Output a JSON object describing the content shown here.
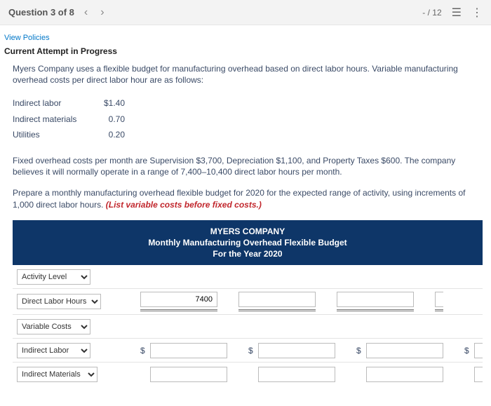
{
  "topbar": {
    "question_label": "Question 3 of 8",
    "score": "- / 12"
  },
  "links": {
    "view_policies": "View Policies"
  },
  "attempt_title": "Current Attempt in Progress",
  "body": {
    "p1": "Myers Company uses a flexible budget for manufacturing overhead based on direct labor hours. Variable manufacturing overhead costs per direct labor hour are as follows:",
    "costs": [
      {
        "label": "Indirect labor",
        "value": "$1.40"
      },
      {
        "label": "Indirect materials",
        "value": "0.70"
      },
      {
        "label": "Utilities",
        "value": "0.20"
      }
    ],
    "p2": "Fixed overhead costs per month are Supervision $3,700, Depreciation $1,100, and Property Taxes $600. The company believes it will normally operate in a range of 7,400–10,400 direct labor hours per month.",
    "p3a": "Prepare a monthly manufacturing overhead flexible budget for 2020 for the expected range of activity, using increments of 1,000 direct labor hours. ",
    "p3b": "(List variable costs before fixed costs.)"
  },
  "budget_header": {
    "l1": "MYERS COMPANY",
    "l2": "Monthly Manufacturing Overhead Flexible Budget",
    "l3": "For the Year 2020"
  },
  "rows": {
    "activity_level": {
      "selected": "Activity Level"
    },
    "dlh": {
      "selected": "Direct Labor Hours",
      "c1": "7400",
      "c2": "",
      "c3": ""
    },
    "variable_costs": {
      "selected": "Variable Costs"
    },
    "indirect_labor": {
      "selected": "Indirect Labor",
      "c1": "",
      "c2": "",
      "c3": ""
    },
    "indirect_materials": {
      "selected": "Indirect Materials",
      "c1": "",
      "c2": "",
      "c3": ""
    }
  },
  "dollar": "$"
}
